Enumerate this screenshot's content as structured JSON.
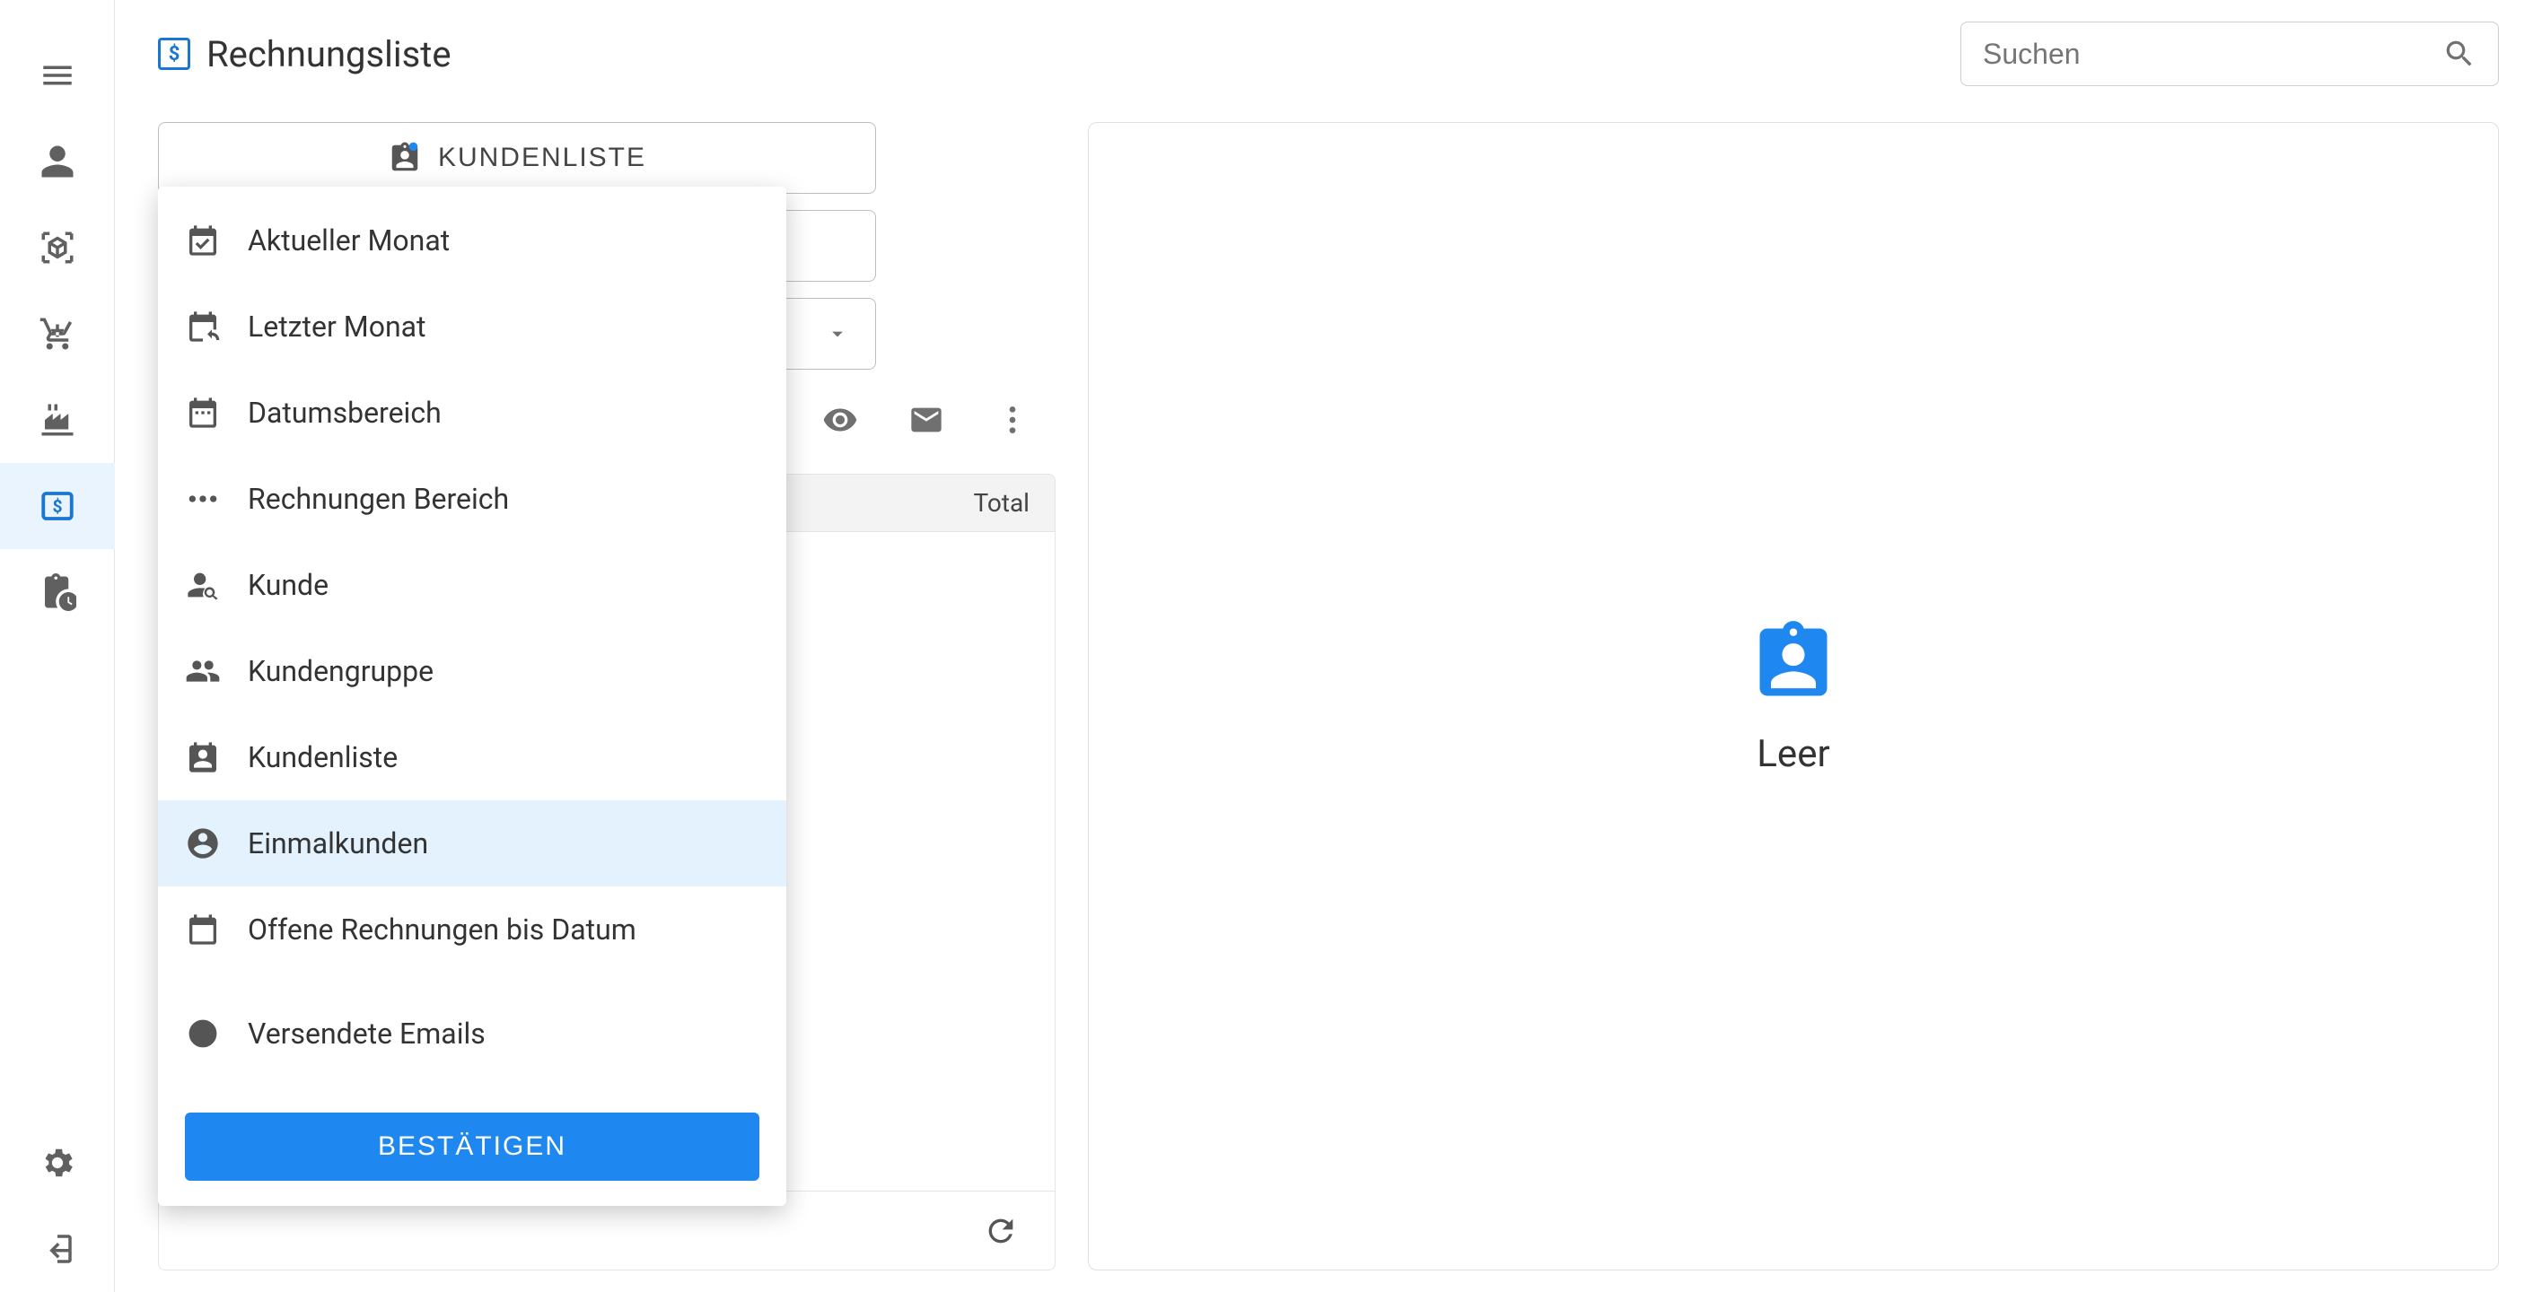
{
  "header": {
    "title": "Rechnungsliste",
    "search_placeholder": "Suchen"
  },
  "filters": {
    "kundenliste_label": "KUNDENLISTE",
    "dropdown": {
      "items": [
        {
          "label": "Aktueller Monat",
          "icon": "calendar-check"
        },
        {
          "label": "Letzter Monat",
          "icon": "calendar-undo"
        },
        {
          "label": "Datumsbereich",
          "icon": "date-range"
        },
        {
          "label": "Rechnungen Bereich",
          "icon": "dots-range"
        },
        {
          "label": "Kunde",
          "icon": "person-search"
        },
        {
          "label": "Kundengruppe",
          "icon": "group"
        },
        {
          "label": "Kundenliste",
          "icon": "contact-list"
        },
        {
          "label": "Einmalkunden",
          "icon": "account-circle",
          "hover": true
        },
        {
          "label": "Offene Rechnungen bis Datum",
          "icon": "calendar-blank"
        },
        {
          "label": "Versendete Emails",
          "icon": "radio-unchecked"
        }
      ],
      "confirm_label": "BESTÄTIGEN"
    }
  },
  "table": {
    "header_total": "Total"
  },
  "detail": {
    "empty_label": "Leer"
  },
  "sidebar": {
    "active_index": 4
  }
}
